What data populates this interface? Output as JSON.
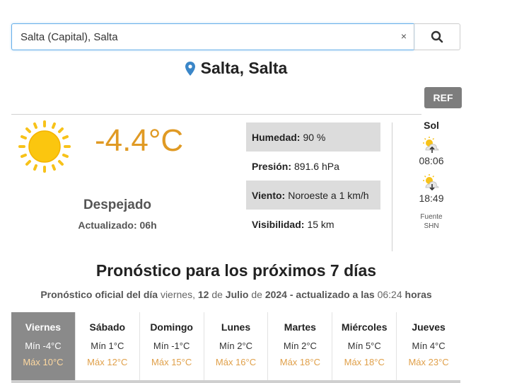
{
  "search": {
    "value": "Salta (Capital), Salta",
    "clear_label": "×",
    "button_icon": "search-icon"
  },
  "location": {
    "name": "Salta, Salta",
    "icon": "map-marker-icon"
  },
  "ref_label": "REF",
  "current": {
    "temperature": "-4.4°C",
    "condition": "Despejado",
    "updated": "Actualizado: 06h",
    "icon": "sun-icon"
  },
  "details": [
    {
      "label": "Humedad:",
      "value": "90 %"
    },
    {
      "label": "Presión:",
      "value": "891.6 hPa"
    },
    {
      "label": "Viento:",
      "value": "Noroeste a 1 km/h"
    },
    {
      "label": "Visibilidad:",
      "value": "15 km"
    }
  ],
  "sol": {
    "title": "Sol",
    "sunrise": "08:06",
    "sunset": "18:49",
    "source_line1": "Fuente",
    "source_line2": "SHN"
  },
  "forecast": {
    "title": "Pronóstico para los próximos 7 días",
    "subtitle_prefix": "Pronóstico oficial del día",
    "subtitle_weekday": "viernes,",
    "subtitle_day": "12",
    "subtitle_de1": "de",
    "subtitle_month": "Julio",
    "subtitle_de2": "de",
    "subtitle_year": "2024",
    "subtitle_updated": "- actualizado a las",
    "subtitle_time": "06:24",
    "subtitle_horas": "horas",
    "days": [
      {
        "name": "Viernes",
        "min": "Mín -4°C",
        "max": "Máx 10°C"
      },
      {
        "name": "Sábado",
        "min": "Mín 1°C",
        "max": "Máx 12°C"
      },
      {
        "name": "Domingo",
        "min": "Mín -1°C",
        "max": "Máx 15°C"
      },
      {
        "name": "Lunes",
        "min": "Mín 2°C",
        "max": "Máx 16°C"
      },
      {
        "name": "Martes",
        "min": "Mín 2°C",
        "max": "Máx 18°C"
      },
      {
        "name": "Miércoles",
        "min": "Mín 5°C",
        "max": "Máx 18°C"
      },
      {
        "name": "Jueves",
        "min": "Mín 4°C",
        "max": "Máx 23°C"
      }
    ]
  },
  "colors": {
    "accent_temp": "#e09a24",
    "active_day": "#8a8a8a",
    "max_temp": "#e0a04a"
  }
}
